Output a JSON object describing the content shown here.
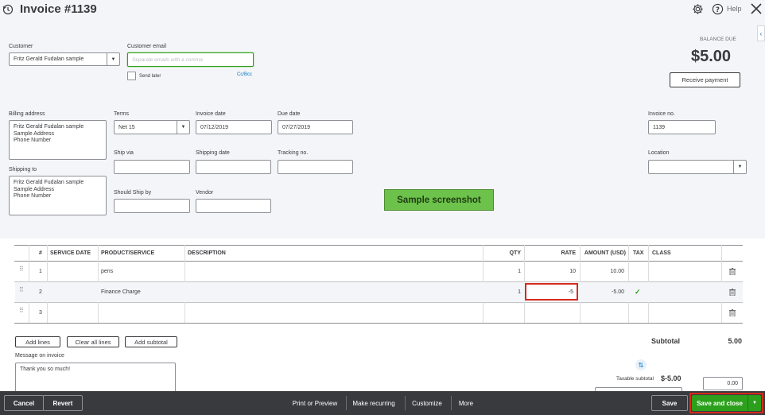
{
  "header": {
    "title": "Invoice #1139",
    "help_label": "Help"
  },
  "customer": {
    "customer_label": "Customer",
    "customer_value": "Fritz Gerald Fudalan sample",
    "email_label": "Customer email",
    "email_placeholder": "Separate emails with a comma",
    "send_later_label": "Send later",
    "cc_bcc_label": "Cc/Bcc"
  },
  "balance": {
    "label": "BALANCE DUE",
    "amount": "$5.00",
    "receive_payment_label": "Receive payment"
  },
  "billing": {
    "billing_label": "Billing address",
    "billing_value": "Fritz Gerald Fudalan sample\nSample Address\nPhone Number",
    "shipping_label": "Shipping to",
    "shipping_value": "Fritz Gerald Fudalan sample\nSample Address\nPhone Number"
  },
  "fields": {
    "terms_label": "Terms",
    "terms_value": "Net 15",
    "invoice_date_label": "Invoice date",
    "invoice_date_value": "07/12/2019",
    "due_date_label": "Due date",
    "due_date_value": "07/27/2019",
    "ship_via_label": "Ship via",
    "shipping_date_label": "Shipping date",
    "tracking_label": "Tracking no.",
    "should_ship_label": "Should Ship by",
    "vendor_label": "Vendor",
    "invoice_no_label": "Invoice no.",
    "invoice_no_value": "1139",
    "location_label": "Location"
  },
  "watermark": "Sample screenshot",
  "table": {
    "headers": {
      "num": "#",
      "service_date": "SERVICE DATE",
      "product": "PRODUCT/SERVICE",
      "description": "DESCRIPTION",
      "qty": "QTY",
      "rate": "RATE",
      "amount": "AMOUNT (USD)",
      "tax": "TAX",
      "class": "CLASS"
    },
    "rows": [
      {
        "num": "1",
        "product": "pens",
        "qty": "1",
        "rate": "10",
        "amount": "10.00",
        "tax": ""
      },
      {
        "num": "2",
        "product": "Finance Charge",
        "qty": "1",
        "rate": "-5",
        "amount": "-5.00",
        "tax": "✓"
      },
      {
        "num": "3",
        "product": "",
        "qty": "",
        "rate": "",
        "amount": "",
        "tax": ""
      }
    ]
  },
  "line_buttons": {
    "add_lines": "Add lines",
    "clear_all_lines": "Clear all lines",
    "add_subtotal": "Add subtotal"
  },
  "message": {
    "label": "Message on invoice",
    "value": "Thank you so much!"
  },
  "totals": {
    "subtotal_label": "Subtotal",
    "subtotal_value": "5.00",
    "taxable_label": "Taxable subtotal",
    "taxable_value": "$-5.00",
    "tax_input_value": "0.00"
  },
  "footer": {
    "cancel": "Cancel",
    "revert": "Revert",
    "print_preview": "Print or Preview",
    "make_recurring": "Make recurring",
    "customize": "Customize",
    "more": "More",
    "save": "Save",
    "save_and_close": "Save and close"
  },
  "colors": {
    "footer_bg": "#393a3d",
    "save_close_bg": "#2ca01c",
    "highlight": "#d52b1e",
    "watermark_bg": "#6cc24a"
  }
}
